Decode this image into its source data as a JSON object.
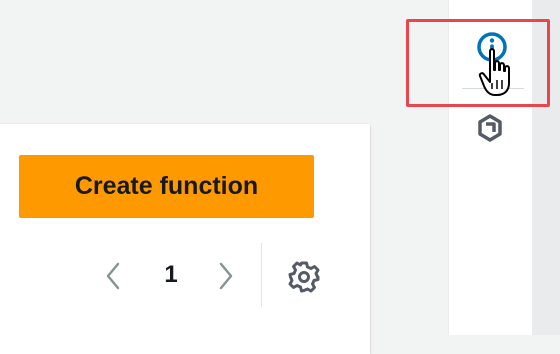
{
  "buttons": {
    "create_function_label": "Create function"
  },
  "pagination": {
    "current_page": "1",
    "prev_icon": "chevron-left-icon",
    "next_icon": "chevron-right-icon"
  },
  "toolbar": {
    "settings_icon": "gear-icon"
  },
  "tools_panel": {
    "info_icon": "info-icon",
    "shortcuts_icon": "hex-shortcuts-icon"
  },
  "annotation": {
    "highlight_color": "#e8474f",
    "cursor_icon": "hand-pointer-icon"
  },
  "colors": {
    "primary_button": "#ff9900",
    "info_blue": "#0073bb",
    "icon_dark": "#545b64",
    "icon_muted": "#879596",
    "page_bg": "#f2f3f3"
  }
}
